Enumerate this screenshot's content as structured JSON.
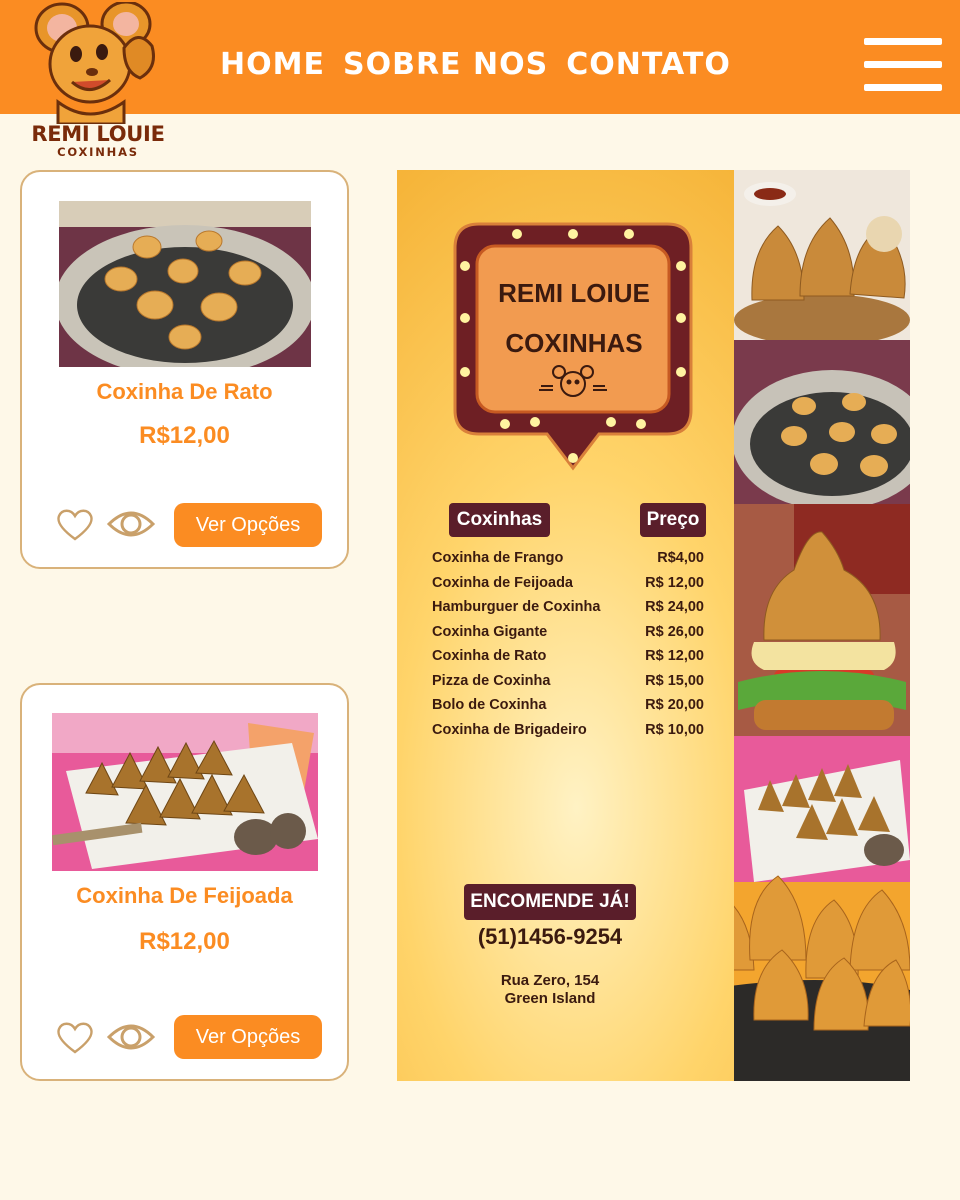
{
  "header": {
    "nav": [
      "HOME",
      "SOBRE NOS",
      "CONTATO"
    ],
    "menu_icon": "hamburger-menu-icon"
  },
  "logo": {
    "title": "REMI LOUIE",
    "subtitle": "COXINHAS",
    "icon": "mouse-mascot-icon"
  },
  "products": [
    {
      "name": "Coxinha De Rato",
      "price": "R$12,00",
      "button": "Ver Opções",
      "image": "mouse-shaped-coxinhas-photo"
    },
    {
      "name": "Coxinha De Feijoada",
      "price": "R$12,00",
      "button": "Ver Opções",
      "image": "feijoada-coxinhas-photo"
    }
  ],
  "flyer": {
    "sign_line1": "REMI LOIUE",
    "sign_line2": "COXINHAS",
    "col_item": "Coxinhas",
    "col_price": "Preço",
    "menu": [
      {
        "item": "Coxinha de Frango",
        "price": "R$4,00"
      },
      {
        "item": "Coxinha de Feijoada",
        "price": "R$ 12,00"
      },
      {
        "item": "Hamburguer de Coxinha",
        "price": "R$ 24,00"
      },
      {
        "item": "Coxinha Gigante",
        "price": "R$ 26,00"
      },
      {
        "item": "Coxinha de Rato",
        "price": "R$ 12,00"
      },
      {
        "item": "Pizza de Coxinha",
        "price": "R$ 15,00"
      },
      {
        "item": "Bolo de Coxinha",
        "price": "R$ 20,00"
      },
      {
        "item": "Coxinha de Brigadeiro",
        "price": "R$ 10,00"
      }
    ],
    "cta": "ENCOMENDE JÁ!",
    "phone": "(51)1456-9254",
    "address_line1": "Rua Zero, 154",
    "address_line2": "Green Island"
  },
  "colors": {
    "brand_orange": "#fb8c22",
    "page_bg": "#fef8e8",
    "dark_brown": "#5a1e2a"
  }
}
